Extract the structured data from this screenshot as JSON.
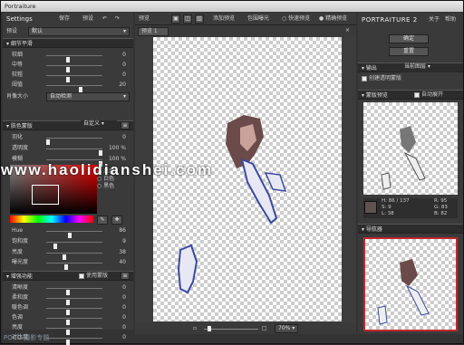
{
  "window": {
    "title": "Portraiture"
  },
  "left_panel": {
    "settings_label": "Settings",
    "save_label": "保存",
    "preset_label": "预设",
    "preset_row": {
      "label": "预设",
      "value": "默认"
    },
    "detail_smoothing": {
      "header": "细节平滑",
      "sliders": [
        {
          "label": "较细",
          "value": "0"
        },
        {
          "label": "中等",
          "value": "0"
        },
        {
          "label": "较粗",
          "value": "0"
        },
        {
          "label": "阈值",
          "value": "20"
        }
      ],
      "portrait_size": {
        "label": "肖像大小",
        "value": "自动检测"
      }
    },
    "skin_mask": {
      "header": "肤色蒙版",
      "mode": "自定义",
      "sliders": [
        {
          "label": "羽化",
          "value": "0"
        },
        {
          "label": "透明度",
          "value": "100 %"
        },
        {
          "label": "模糊",
          "value": "100 %"
        }
      ],
      "radios": [
        "显示",
        "白色",
        "黑色"
      ],
      "hsl_sliders": [
        {
          "label": "Hue",
          "value": "86"
        },
        {
          "label": "饱和度",
          "value": "9"
        },
        {
          "label": "亮度",
          "value": "38"
        },
        {
          "label": "曝光度",
          "value": "40"
        }
      ]
    },
    "enhancements": {
      "header": "增强功能",
      "use_mask_label": "使用蒙版",
      "sliders": [
        {
          "label": "清晰度",
          "value": "0"
        },
        {
          "label": "柔和度",
          "value": "0"
        },
        {
          "label": "暖色调",
          "value": "0"
        },
        {
          "label": "色调",
          "value": "0"
        },
        {
          "label": "亮度",
          "value": "0"
        },
        {
          "label": "对比度",
          "value": "0"
        }
      ]
    }
  },
  "toolbar": {
    "preview_label": "预览",
    "add_preview_label": "添加预览",
    "mask_label": "包围曝光",
    "quick_preview_label": "快速预览",
    "accurate_preview_label": "精确预览",
    "tab_label": "预览 1"
  },
  "zoom": {
    "value": "70%"
  },
  "right_panel": {
    "brand": "PORTRAITURE 2",
    "about_label": "关于",
    "help_label": "帮助",
    "ok_label": "确定",
    "reset_label": "重置",
    "output": {
      "header": "输出",
      "value": "当前图层",
      "checkbox_label": "创建透明蒙版"
    },
    "mask_preview": {
      "header": "蒙版预览",
      "auto_expand_label": "自动展开"
    },
    "color_readout": {
      "h": "H: 86 / 137",
      "s": "S: 9",
      "l": "L: 38",
      "r": "R: 95",
      "g": "G: 83",
      "b": "B: 82"
    },
    "navigator_header": "导航器"
  },
  "watermark": "www.haolidianshei.com",
  "corner_logo": "POCO 摄影专题"
}
